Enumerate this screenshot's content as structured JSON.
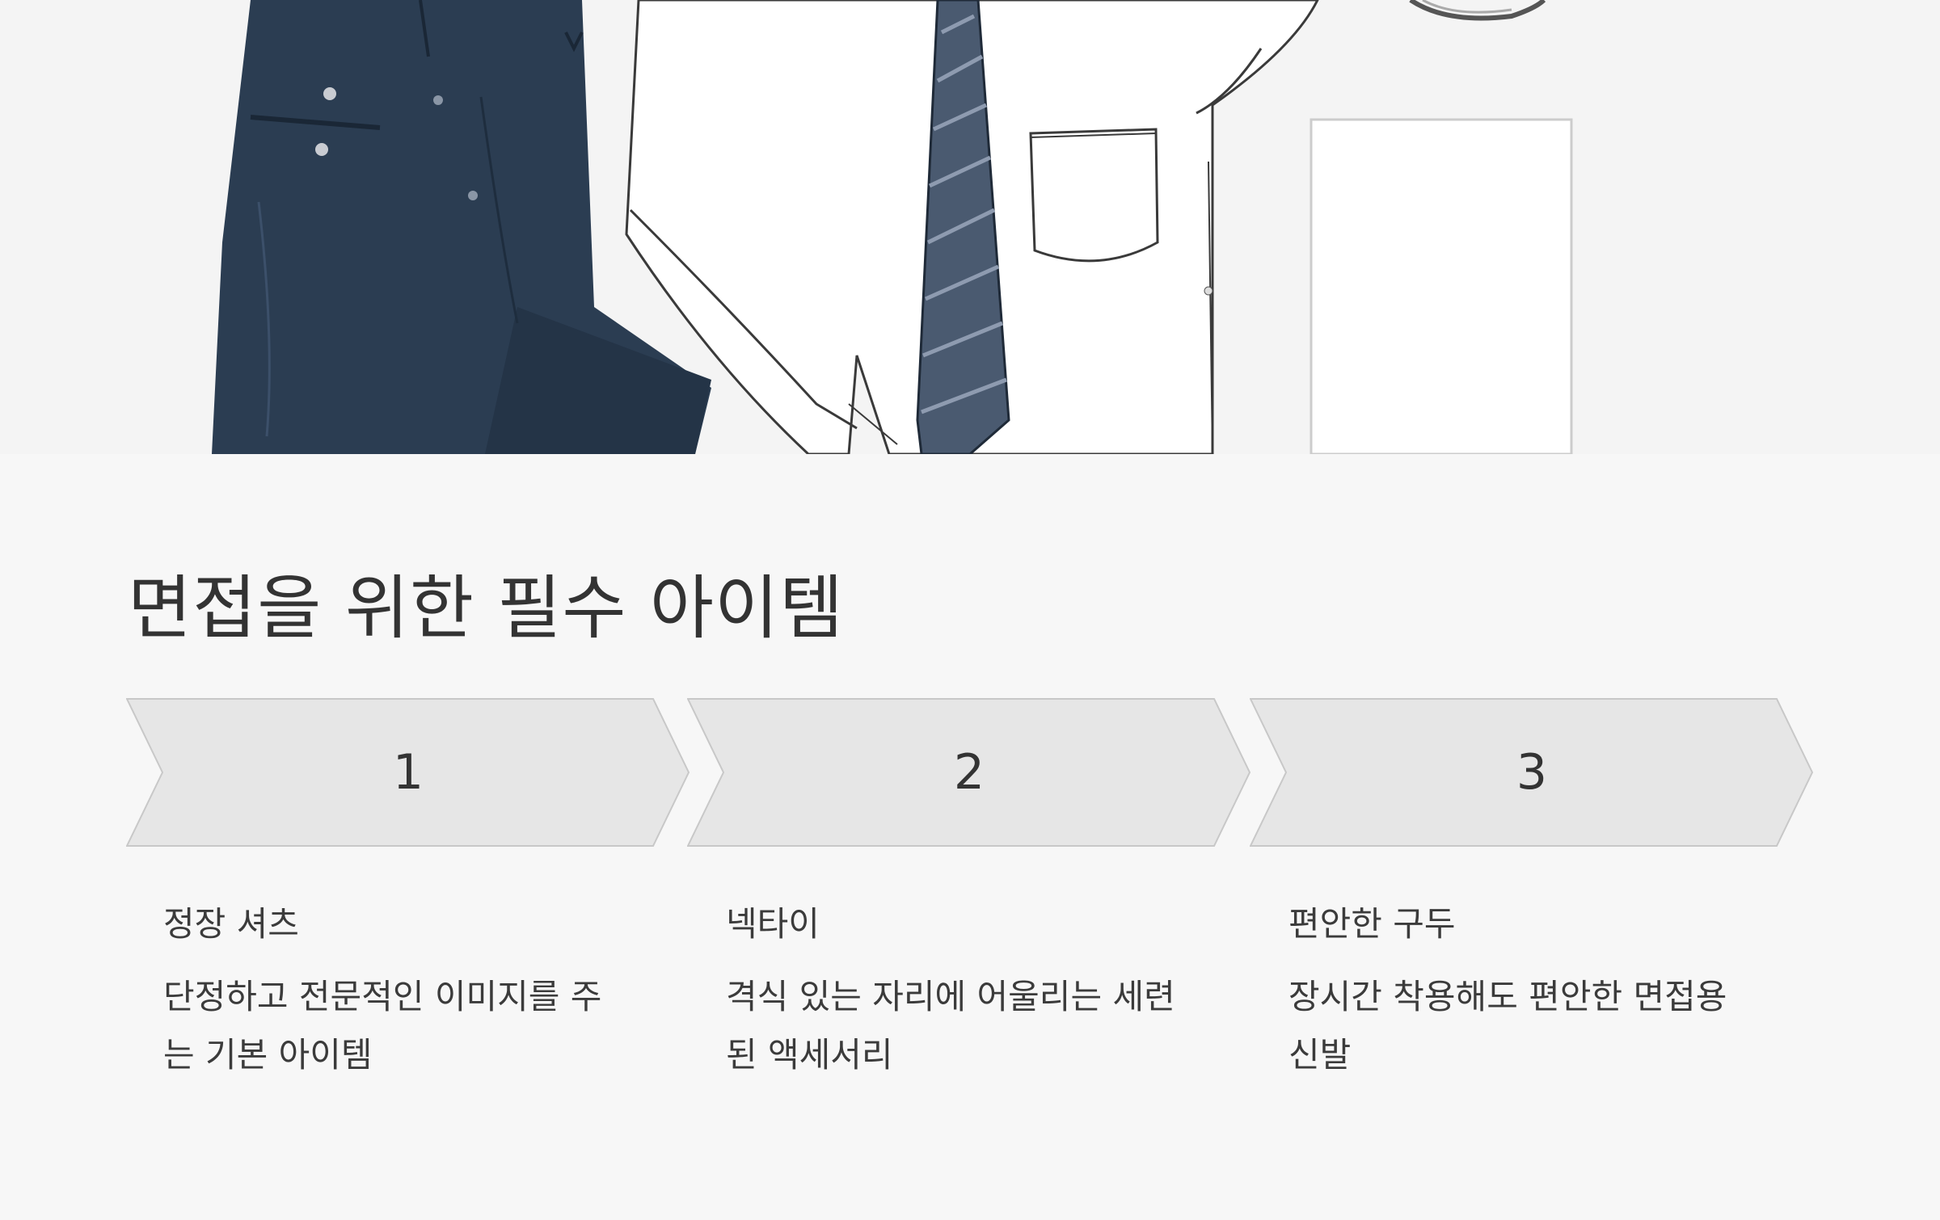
{
  "page": {
    "title": "면접을 위한 필수 아이템",
    "background": "#f7f7f7"
  },
  "hero": {
    "illustration": "flat-lay-of-interview-outfit",
    "items": [
      "navy-trousers-icon",
      "white-dress-shirt-icon",
      "striped-necktie-icon",
      "white-card-icon",
      "belt-icon"
    ],
    "colors": {
      "trousers": "#2b3d52",
      "tie": "#4a5a70"
    }
  },
  "steps": [
    {
      "number": "1",
      "title": "정장 셔츠",
      "desc_line1": "단정하고 전문적인 이미지를 주",
      "desc_line2": "는 기본 아이템"
    },
    {
      "number": "2",
      "title": "넥타이",
      "desc_line1": "격식 있는 자리에 어울리는 세련",
      "desc_line2": "된 액세서리"
    },
    {
      "number": "3",
      "title": "편안한 구두",
      "desc_line1": "장시간 착용해도 편안한 면접용",
      "desc_line2": "신발"
    }
  ],
  "colors": {
    "chevron_fill": "#e6e6e6",
    "chevron_stroke": "#c8c8c8",
    "text": "#3a3a3a"
  }
}
